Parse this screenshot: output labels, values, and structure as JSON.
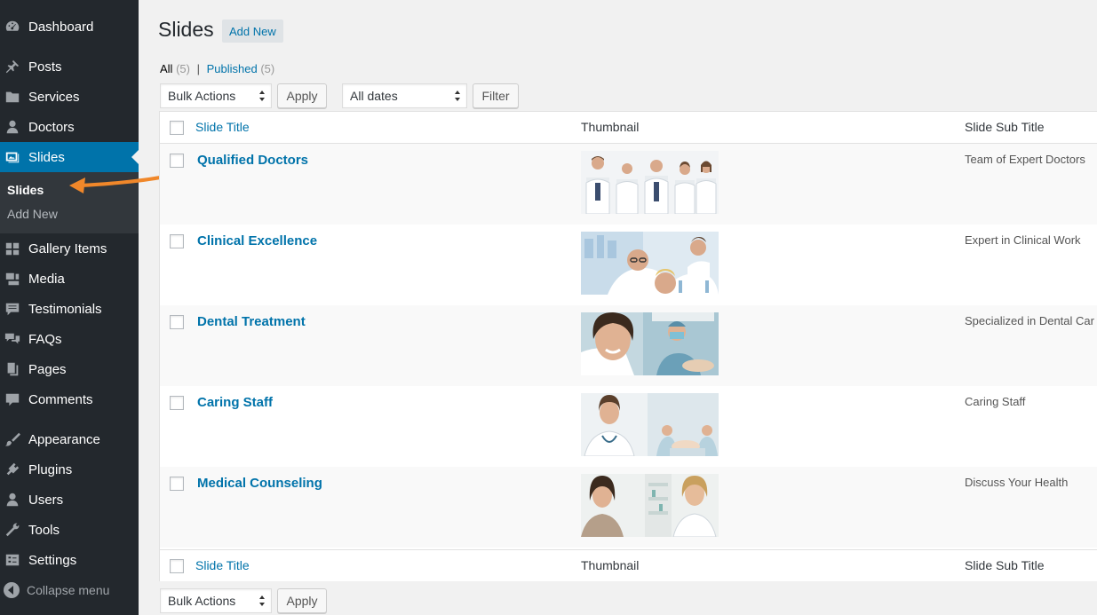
{
  "sidebar": {
    "items": [
      {
        "label": "Dashboard",
        "icon": "dashboard-icon"
      },
      {
        "label": "Posts",
        "icon": "pin-icon"
      },
      {
        "label": "Services",
        "icon": "folder-icon"
      },
      {
        "label": "Doctors",
        "icon": "user-icon"
      },
      {
        "label": "Slides",
        "icon": "slides-icon"
      },
      {
        "label": "Gallery Items",
        "icon": "gallery-icon"
      },
      {
        "label": "Media",
        "icon": "media-icon"
      },
      {
        "label": "Testimonials",
        "icon": "testimonial-icon"
      },
      {
        "label": "FAQs",
        "icon": "faq-icon"
      },
      {
        "label": "Pages",
        "icon": "pages-icon"
      },
      {
        "label": "Comments",
        "icon": "comment-icon"
      },
      {
        "label": "Appearance",
        "icon": "paintbrush-icon"
      },
      {
        "label": "Plugins",
        "icon": "plugin-icon"
      },
      {
        "label": "Users",
        "icon": "users-icon"
      },
      {
        "label": "Tools",
        "icon": "wrench-icon"
      },
      {
        "label": "Settings",
        "icon": "settings-icon"
      }
    ],
    "submenu": [
      {
        "label": "Slides"
      },
      {
        "label": "Add New"
      }
    ],
    "collapse_label": "Collapse menu"
  },
  "header": {
    "title": "Slides",
    "add_new": "Add New"
  },
  "filters": {
    "all_label": "All",
    "all_count": "(5)",
    "separator": "|",
    "published_label": "Published",
    "published_count": "(5)"
  },
  "toolbar": {
    "bulk_actions": "Bulk Actions",
    "apply": "Apply",
    "all_dates": "All dates",
    "filter": "Filter"
  },
  "table": {
    "headers": {
      "title": "Slide Title",
      "thumbnail": "Thumbnail",
      "subtitle": "Slide Sub Title"
    },
    "rows": [
      {
        "title": "Qualified Doctors",
        "subtitle": "Team of Expert Doctors",
        "thumb": "doctors-team"
      },
      {
        "title": "Clinical Excellence",
        "subtitle": "Expert in Clinical Work",
        "thumb": "clinical-lab"
      },
      {
        "title": "Dental Treatment",
        "subtitle": "Specialized in Dental Car",
        "thumb": "dental"
      },
      {
        "title": "Caring Staff",
        "subtitle": "Caring Staff",
        "thumb": "caring-staff"
      },
      {
        "title": "Medical Counseling",
        "subtitle": "Discuss Your Health",
        "thumb": "counseling"
      }
    ]
  },
  "colors": {
    "sidebar_bg": "#23282d",
    "accent": "#0073aa",
    "annotation_arrow": "#f0872a"
  }
}
